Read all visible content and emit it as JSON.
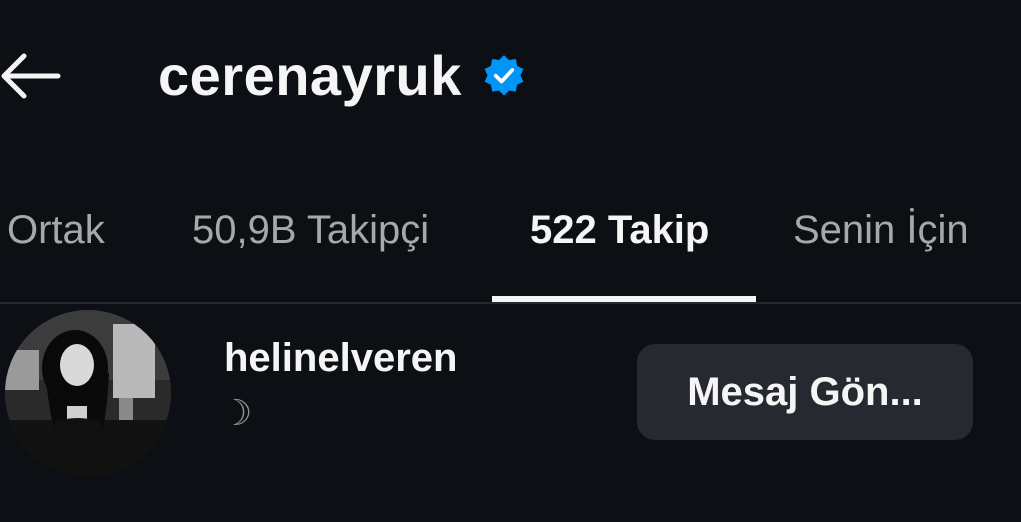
{
  "header": {
    "username": "cerenayruk",
    "verified_color": "#0095f6"
  },
  "tabs": [
    {
      "label": "Ortak"
    },
    {
      "label": "50,9B Takipçi"
    },
    {
      "label": "522 Takip",
      "active": true
    },
    {
      "label": "Senin İçin"
    }
  ],
  "list": {
    "items": [
      {
        "handle": "helinelveren",
        "note": "☽",
        "action_label": "Mesaj Gön..."
      }
    ]
  },
  "icons": [
    "back-arrow-icon",
    "verified-badge-icon"
  ]
}
